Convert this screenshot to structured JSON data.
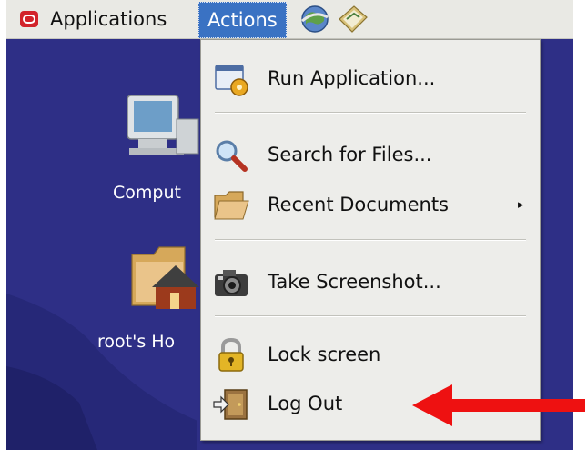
{
  "panel": {
    "applications_label": "Applications",
    "actions_label": "Actions",
    "launchers": [
      "web-browser-icon",
      "email-icon"
    ]
  },
  "desktop": {
    "icons": [
      {
        "label": "Comput",
        "icon": "computer-icon"
      },
      {
        "label": "root's Ho",
        "icon": "home-folder-icon"
      }
    ]
  },
  "actions_menu": {
    "items": [
      {
        "label": "Run Application...",
        "icon": "run-application-icon"
      },
      {
        "label": "Search for Files...",
        "icon": "search-icon"
      },
      {
        "label": "Recent Documents",
        "icon": "folder-icon",
        "submenu": true
      },
      {
        "label": "Take Screenshot...",
        "icon": "camera-icon"
      },
      {
        "label": "Lock screen",
        "icon": "lock-icon"
      },
      {
        "label": "Log Out",
        "icon": "log-out-icon"
      }
    ],
    "submenu_arrow": "▸"
  },
  "colors": {
    "panel_bg": "#e9e9e4",
    "actions_highlight": "#3a72c3",
    "desktop_bg": "#2e2f86",
    "menu_bg": "#ededea",
    "annotation_arrow": "#ee1111"
  }
}
